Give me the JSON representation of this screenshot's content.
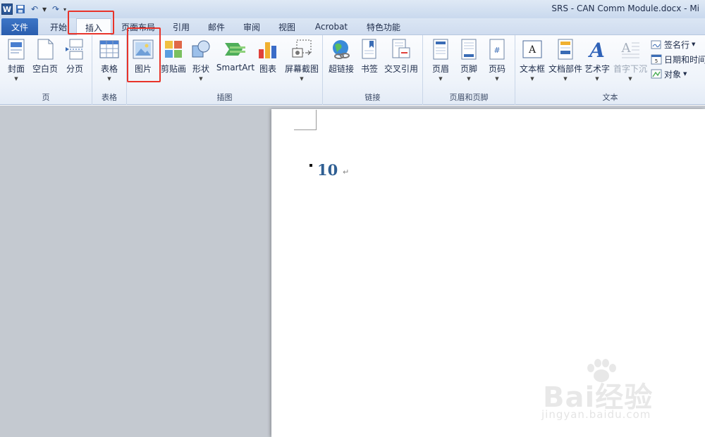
{
  "window": {
    "title": "SRS - CAN Comm Module.docx - Mi",
    "logo_letter": "W"
  },
  "tabs": {
    "file": "文件",
    "items": [
      "开始",
      "插入",
      "页面布局",
      "引用",
      "邮件",
      "审阅",
      "视图",
      "Acrobat",
      "特色功能"
    ]
  },
  "ribbon": {
    "groups": {
      "pages": "页",
      "tables": "表格",
      "illustrations": "插图",
      "links": "链接",
      "header_footer": "页眉和页脚",
      "text": "文本"
    },
    "buttons": {
      "cover": "封面",
      "blank_page": "空白页",
      "page_break": "分页",
      "table": "表格",
      "picture": "图片",
      "clip_art": "剪贴画",
      "shapes": "形状",
      "smartart": "SmartArt",
      "chart": "图表",
      "screenshot": "屏幕截图",
      "hyperlink": "超链接",
      "bookmark": "书签",
      "cross_ref": "交叉引用",
      "header": "页眉",
      "footer": "页脚",
      "page_number": "页码",
      "text_box": "文本框",
      "quick_parts": "文档部件",
      "wordart": "艺术字",
      "drop_cap": "首字下沉",
      "signature": "签名行",
      "date_time": "日期和时间",
      "object": "对象"
    }
  },
  "document": {
    "heading_number": "10",
    "para_mark": "↵"
  },
  "watermark": {
    "main": "Bai经验",
    "sub": "jingyan.baidu.com"
  },
  "colors": {
    "highlight": "#e8332a",
    "file_tab": "#2a5eae",
    "heading": "#2f5f93"
  }
}
